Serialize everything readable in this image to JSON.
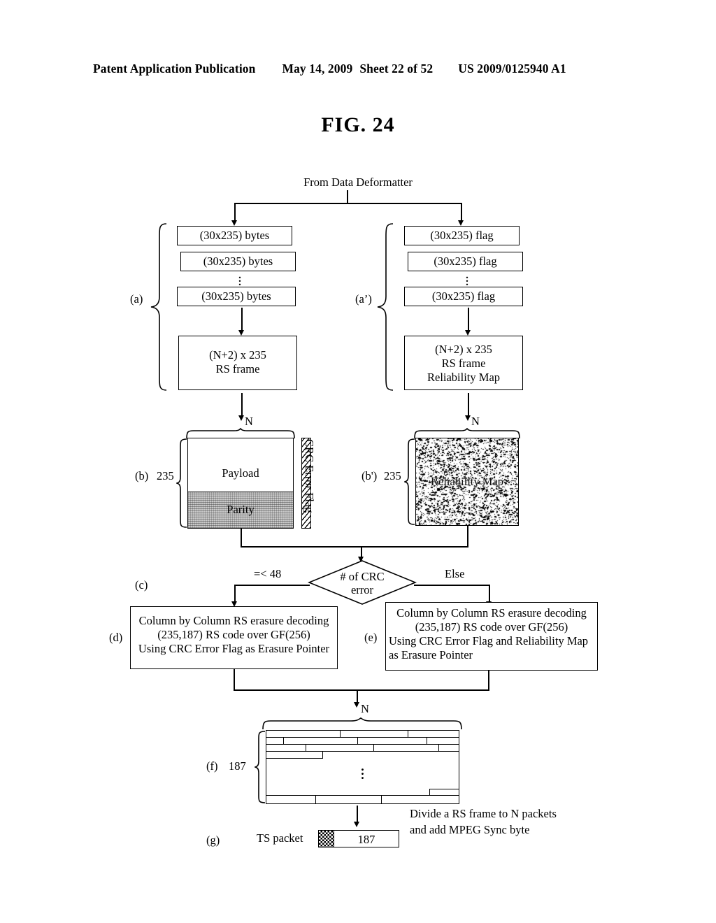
{
  "header": {
    "publication": "Patent Application Publication",
    "date": "May 14, 2009",
    "sheet": "Sheet 22 of 52",
    "patent_number": "US 2009/0125940 A1"
  },
  "figure": {
    "title": "FIG. 24",
    "source_label": "From Data Deformatter"
  },
  "groups": {
    "a": {
      "tag": "(a)",
      "slabs": [
        "(30x235) bytes",
        "(30x235) bytes",
        "(30x235) bytes"
      ],
      "frame_box": "(N+2) x 235\nRS frame",
      "frame_line1": "(N+2) x 235",
      "frame_line2": "RS frame"
    },
    "a_prime": {
      "tag": "(a’)",
      "slabs": [
        "(30x235) flag",
        "(30x235) flag",
        "(30x235) flag"
      ],
      "frame_line1": "(N+2) x 235",
      "frame_line2": "RS frame",
      "frame_line3": "Reliability Map"
    },
    "b": {
      "tag": "(b)",
      "rows_label": "235",
      "cols_label": "N",
      "payload_label": "Payload",
      "parity_label": "Parity",
      "crc_flag_label": "CRC Error Flag"
    },
    "b_prime": {
      "tag": "(b')",
      "rows_label": "235",
      "cols_label": "N",
      "map_label": "Reliability Map"
    },
    "c": {
      "tag": "(c)",
      "decision_line1": "# of CRC",
      "decision_line2": "error",
      "branch_left": "=< 48",
      "branch_right": "Else"
    },
    "d": {
      "tag": "(d)",
      "lines": [
        "Column by Column RS erasure decoding",
        "(235,187) RS code over GF(256)",
        "Using CRC Error Flag as Erasure Pointer"
      ]
    },
    "e": {
      "tag": "(e)",
      "lines": [
        "Column by Column RS erasure decoding",
        "(235,187) RS code over GF(256)",
        "Using CRC Error Flag and Reliability Map",
        "as Erasure Pointer"
      ]
    },
    "f": {
      "tag": "(f)",
      "rows_label": "187",
      "cols_label": "N"
    },
    "g": {
      "tag": "(g)",
      "packet_label": "TS packet",
      "payload_size": "187",
      "note_line1": "Divide a RS frame to N packets",
      "note_line2": "and add MPEG Sync byte"
    }
  },
  "colors": {
    "ink": "#000000",
    "paper": "#ffffff",
    "parity_fill": "#c9c9c9"
  }
}
